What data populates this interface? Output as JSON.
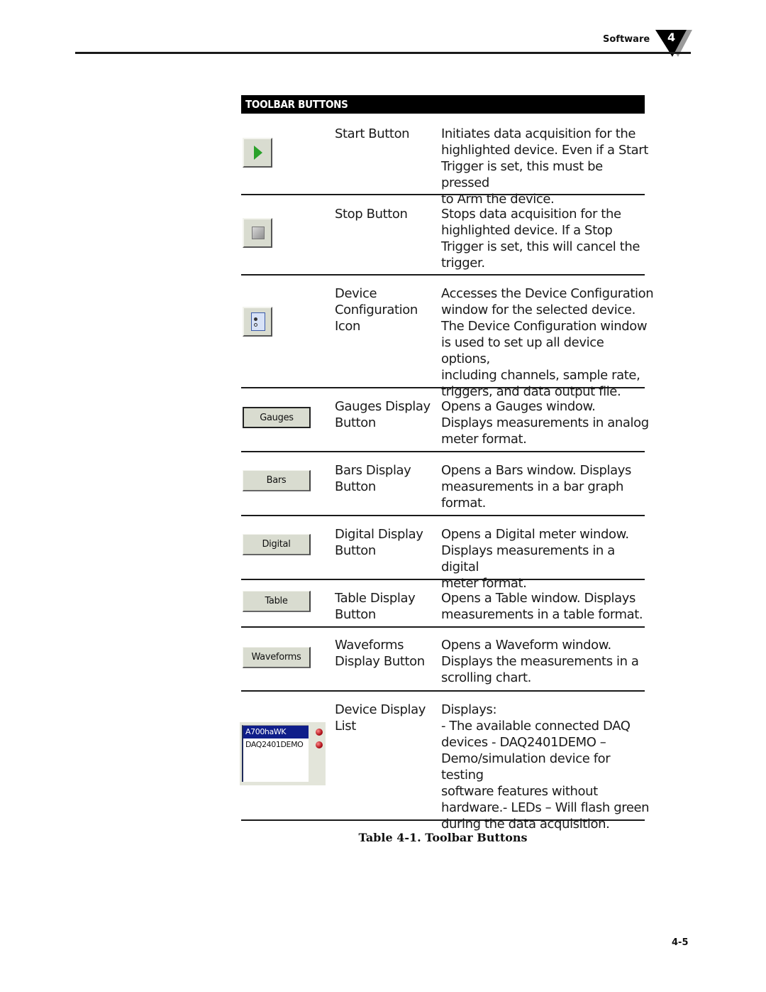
{
  "header": {
    "section": "Software",
    "chapter": "4"
  },
  "table": {
    "title": "TOOLBAR BUTTONS",
    "rows": [
      {
        "name": "Start Button",
        "description": "Initiates data acquisition for the\nhighlighted device.  Even if a Start\nTrigger is set, this must be pressed\nto Arm the device.",
        "icon": "play-icon"
      },
      {
        "name": "Stop Button",
        "description": "Stops data acquisition for the\nhighlighted device.  If a Stop\nTrigger is set, this will cancel the\ntrigger.",
        "icon": "stop-icon"
      },
      {
        "name": "Device\nConfiguration\nIcon",
        "description": "Accesses the Device Configuration\nwindow for the selected device.\nThe Device Configuration window\nis used to set up all device options,\nincluding channels, sample rate,\ntriggers, and data output file.",
        "icon": "device-config-icon"
      },
      {
        "name": "Gauges Display\nButton",
        "description": "Opens a Gauges window.\nDisplays measurements in analog\nmeter format.",
        "button_label": "Gauges"
      },
      {
        "name": "Bars Display\n Button",
        "description": "Opens a Bars window. Displays\nmeasurements in a bar graph\nformat.",
        "button_label": "Bars"
      },
      {
        "name": "Digital Display\nButton",
        "description": "Opens a Digital meter window.\nDisplays measurements in a digital\nmeter format.",
        "button_label": "Digital"
      },
      {
        "name": "Table Display\nButton",
        "description": "Opens a Table window. Displays\nmeasurements in a table format.",
        "button_label": "Table"
      },
      {
        "name": "Waveforms\nDisplay Button",
        "description": "Opens a Waveform window.\nDisplays the measurements in a\nscrolling chart.",
        "button_label": "Waveforms"
      },
      {
        "name": "Device Display\nList",
        "description": "Displays:\n- The available connected DAQ\ndevices  - DAQ2401DEMO –\nDemo/simulation device for testing\nsoftware features without\nhardware.- LEDs – Will flash green\nduring the data acquisition.",
        "devices": [
          "A700haWK",
          "DAQ2401DEMO"
        ]
      }
    ]
  },
  "caption": "Table 4-1. Toolbar Buttons",
  "page_number": "4-5",
  "colors": {
    "button_face": "#d9dcd0",
    "play_green": "#2aa12a",
    "selection_blue": "#0f1e8a",
    "led_red": "#b0101a"
  }
}
